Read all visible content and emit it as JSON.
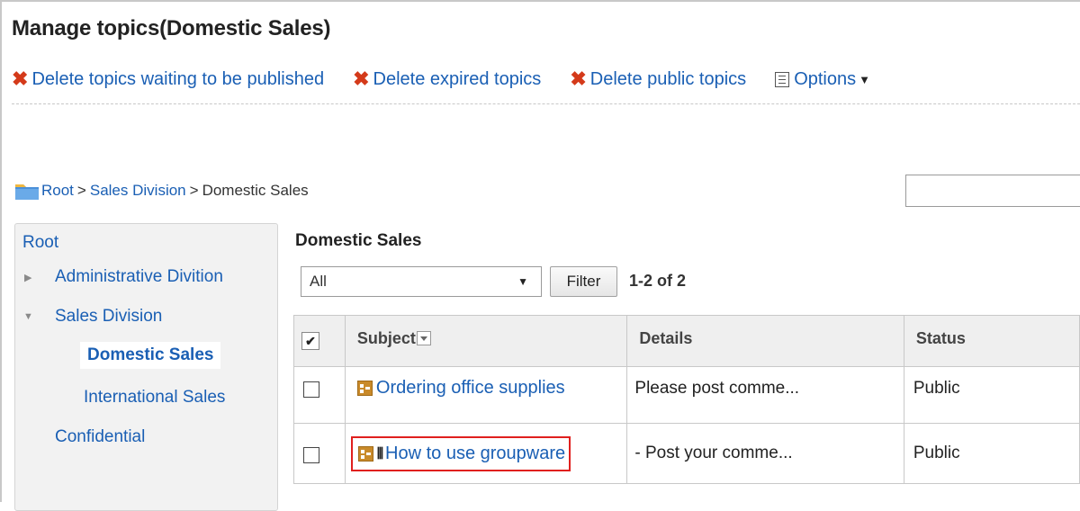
{
  "page": {
    "title": "Manage topics(Domestic Sales)"
  },
  "toolbar": {
    "delete_waiting": "Delete topics waiting to be published",
    "delete_expired": "Delete expired topics",
    "delete_public": "Delete public topics",
    "options": "Options",
    "icons": {
      "delete": "x-mark-icon",
      "options": "list-icon",
      "dropdown": "caret-down-icon"
    }
  },
  "breadcrumb": {
    "items": [
      "Root",
      "Sales Division",
      "Domestic Sales"
    ],
    "separator": ">"
  },
  "sidebar": {
    "root": "Root",
    "items": [
      {
        "label": "Administrative Divition",
        "expanded": false
      },
      {
        "label": "Sales Division",
        "expanded": true
      },
      {
        "label": "Domestic Sales",
        "active": true
      },
      {
        "label": "International Sales"
      },
      {
        "label": "Confidential"
      }
    ]
  },
  "main": {
    "section_title": "Domestic Sales",
    "filter": {
      "selected": "All",
      "button": "Filter"
    },
    "count": "1-2 of 2",
    "table": {
      "headers": {
        "subject": "Subject",
        "details": "Details",
        "status": "Status"
      },
      "rows": [
        {
          "subject": "Ordering office supplies",
          "details": "Please post comme...",
          "status": "Public",
          "attachment": false,
          "highlighted": false
        },
        {
          "subject": "How to use groupware",
          "details": "- Post your comme...",
          "status": "Public",
          "attachment": true,
          "highlighted": true
        }
      ]
    }
  },
  "colors": {
    "link": "#1a5fb4",
    "delete_icon": "#d43a1a",
    "highlight": "#e0201e",
    "header_bg": "#efefef",
    "sidebar_bg": "#f2f2f2"
  }
}
